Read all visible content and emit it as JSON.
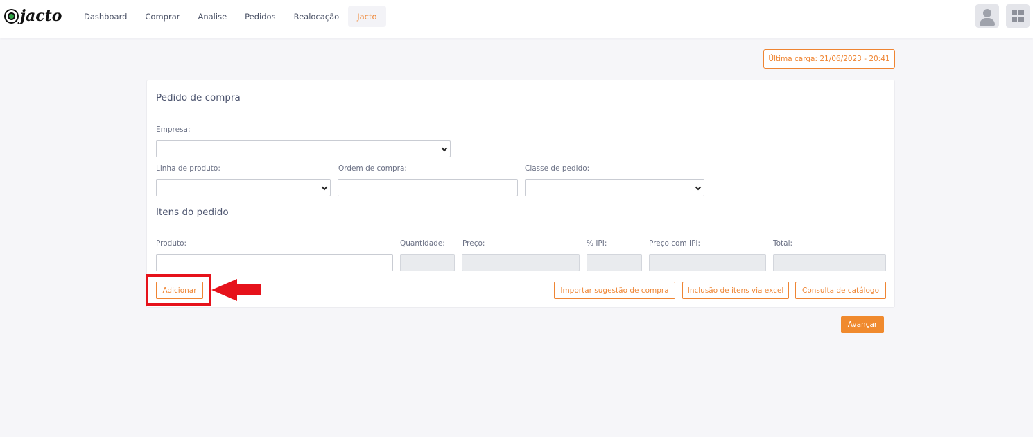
{
  "header": {
    "logo_text": "jacto",
    "nav": [
      {
        "label": "Dashboard"
      },
      {
        "label": "Comprar"
      },
      {
        "label": "Analise"
      },
      {
        "label": "Pedidos"
      },
      {
        "label": "Realocação"
      },
      {
        "label": "Jacto"
      }
    ],
    "active_tab": "Jacto"
  },
  "last_load": "Última carga: 21/06/2023 - 20:41",
  "form": {
    "title": "Pedido de compra",
    "empresa_label": "Empresa:",
    "empresa_value": "",
    "linha_label": "Linha de produto:",
    "linha_value": "",
    "ordem_label": "Ordem de compra:",
    "ordem_value": "",
    "classe_label": "Classe de pedido:",
    "classe_value": "",
    "items_title": "Itens do pedido",
    "produto_label": "Produto:",
    "quantidade_label": "Quantidade:",
    "preco_label": "Preço:",
    "ipi_label": "% IPI:",
    "preco_ipi_label": "Preço com IPI:",
    "total_label": "Total:",
    "add_button": "Adicionar",
    "import_button": "Importar sugestão de compra",
    "excel_button": "Inclusão de itens via excel",
    "catalog_button": "Consulta de catálogo"
  },
  "next_button": "Avançar",
  "colors": {
    "accent": "#ef8533",
    "highlight": "#e6121b",
    "background": "#f6f6f9"
  }
}
